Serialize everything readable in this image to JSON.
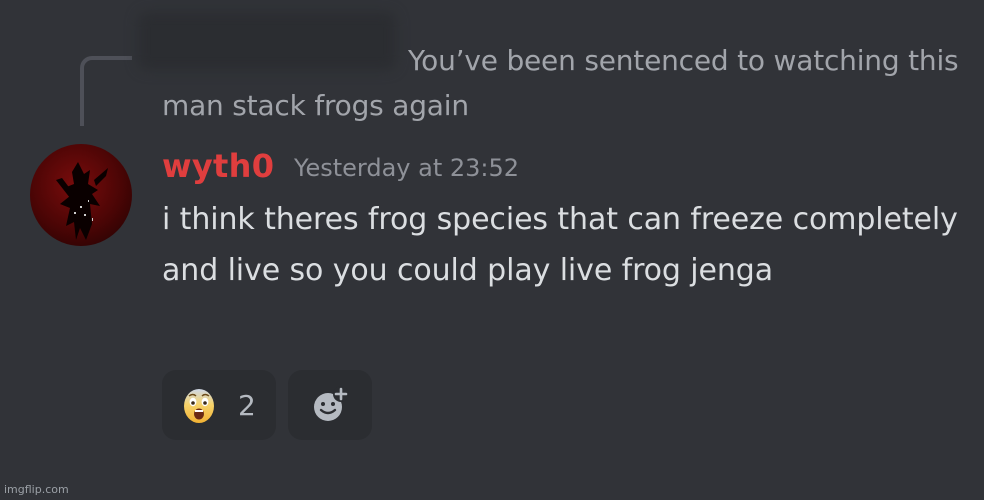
{
  "reply": {
    "text": "You’ve been sentenced to watching this man stack frogs again"
  },
  "message": {
    "author": "wyth0",
    "timestamp": "Yesterday at 23:52",
    "content": "i think theres frog species that can freeze completely and live so you could play live frog jenga",
    "author_color": "#e03e3e"
  },
  "reactions": [
    {
      "emoji_icon": "fearful-face-icon",
      "count": "2"
    }
  ],
  "add_reaction_icon": "add-reaction-icon",
  "watermark": "imgflip.com"
}
